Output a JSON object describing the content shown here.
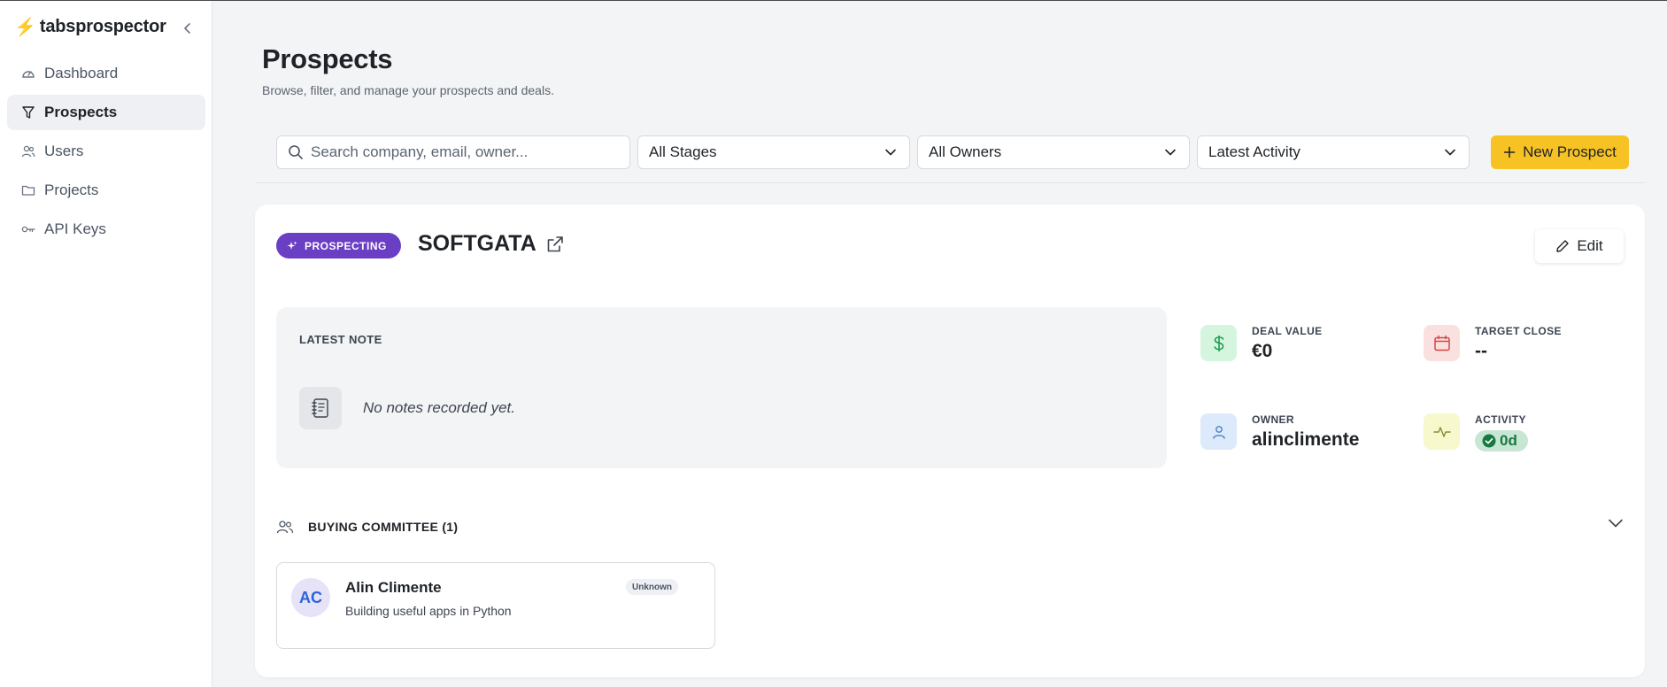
{
  "app": {
    "bolt": "⚡",
    "name": "tabsprospector"
  },
  "sidebar": {
    "items": [
      {
        "label": "Dashboard",
        "icon": "gauge-icon"
      },
      {
        "label": "Prospects",
        "icon": "filter-icon",
        "active": true
      },
      {
        "label": "Users",
        "icon": "users-icon"
      },
      {
        "label": "Projects",
        "icon": "folder-icon"
      },
      {
        "label": "API Keys",
        "icon": "key-icon"
      }
    ]
  },
  "header": {
    "title": "Prospects",
    "subtitle": "Browse, filter, and manage your prospects and deals."
  },
  "filters": {
    "search_placeholder": "Search company, email, owner...",
    "stage": "All Stages",
    "owner": "All Owners",
    "sort": "Latest Activity",
    "new_label": "New Prospect"
  },
  "prospect": {
    "stage": "PROSPECTING",
    "company": "SOFTGATA",
    "edit_label": "Edit",
    "note_label": "LATEST NOTE",
    "note_empty": "No notes recorded yet.",
    "deal_value_label": "DEAL VALUE",
    "deal_value": "€0",
    "target_close_label": "TARGET CLOSE",
    "target_close": "--",
    "owner_label": "OWNER",
    "owner": "alinclimente",
    "activity_label": "ACTIVITY",
    "activity": "0d",
    "committee_title": "BUYING COMMITTEE (1)",
    "contacts": [
      {
        "initials": "AC",
        "name": "Alin Climente",
        "title": "Building useful apps in Python",
        "role": "Unknown"
      }
    ]
  },
  "colors": {
    "accent": "#f7c324",
    "stage_badge": "#6b3fc3",
    "deal_icon_bg": "#d6f5df",
    "target_icon_bg": "#fbe0e0",
    "owner_icon_bg": "#dceafb",
    "activity_icon_bg": "#f7f8cc",
    "activity_pill_bg": "#c8e6d4"
  }
}
